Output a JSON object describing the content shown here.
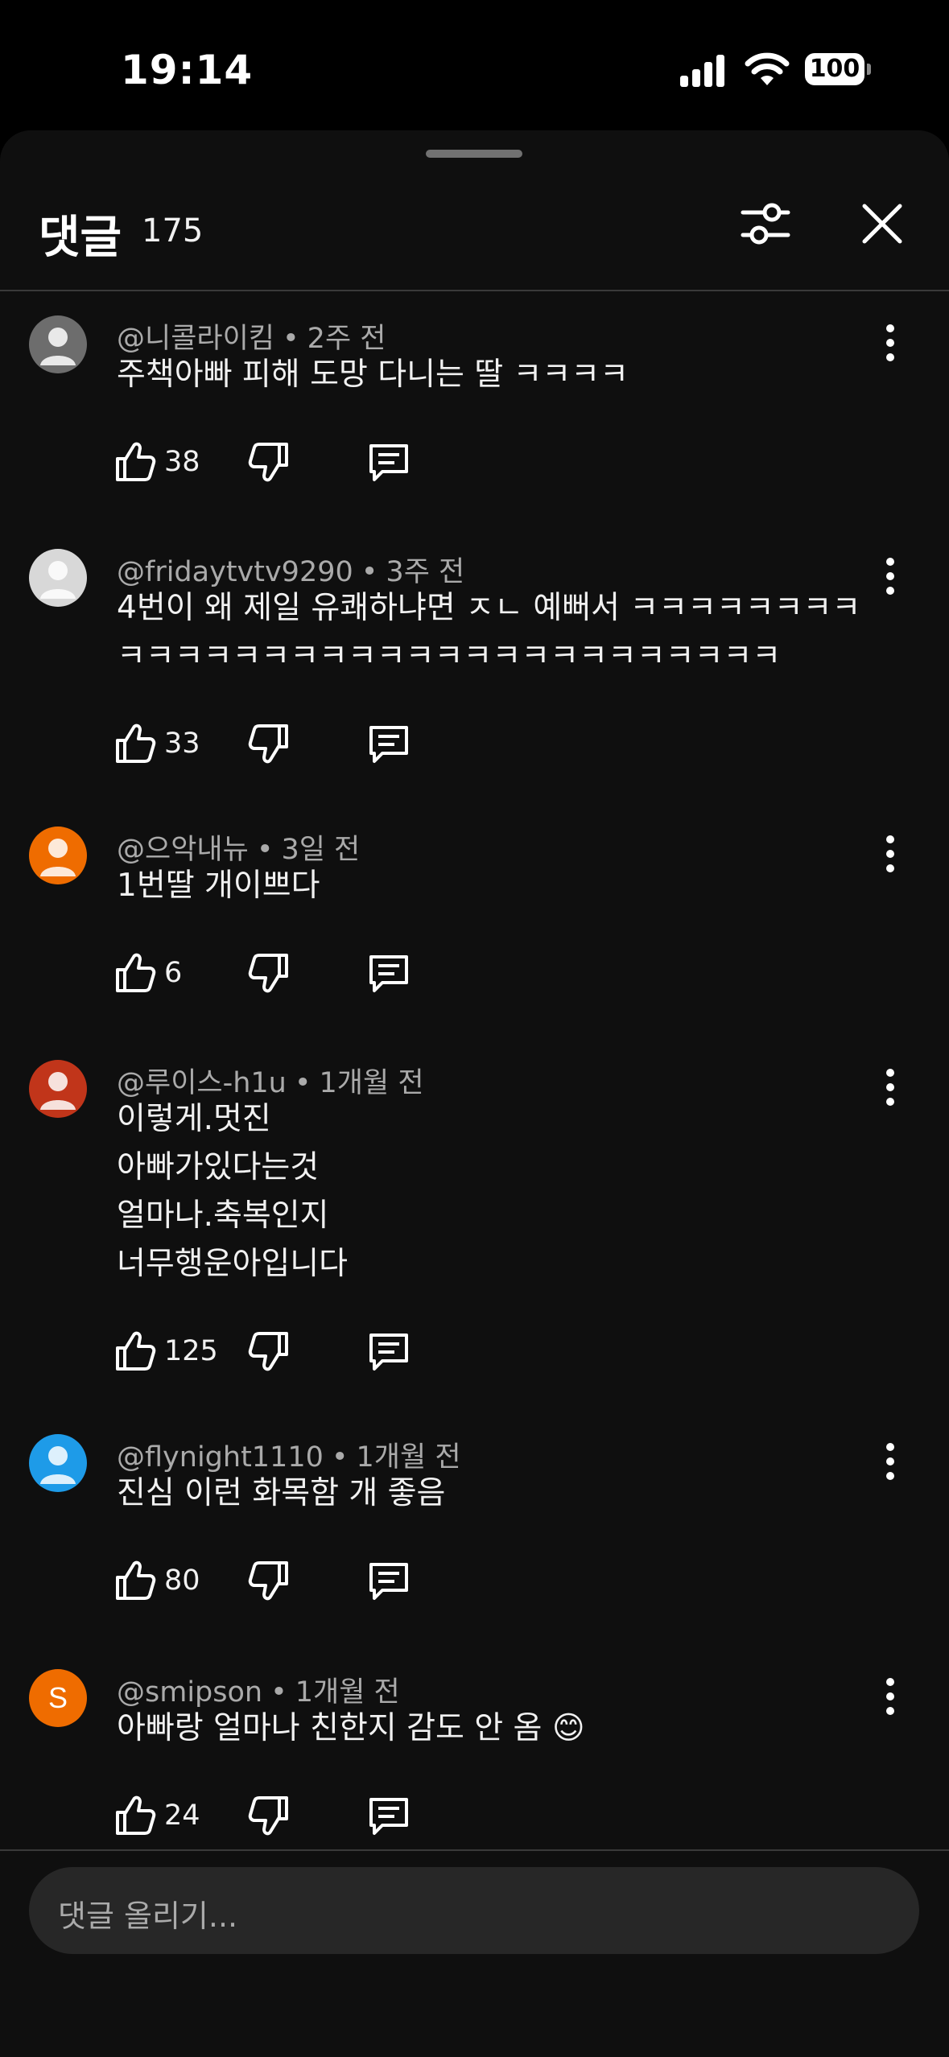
{
  "status": {
    "time": "19:14",
    "battery": "100"
  },
  "header": {
    "title": "댓글",
    "count": "175"
  },
  "comments": [
    {
      "author": "@니콜라이킴",
      "age": "2주 전",
      "text": "주책아빠 피해 도망 다니는 딸 ㅋㅋㅋㅋ",
      "likes": "38",
      "avatar_color": "#6d6d6d"
    },
    {
      "author": "@fridaytvtv9290",
      "age": "3주 전",
      "text": "4번이 왜 제일 유쾌하냐면 ㅈㄴ 예뻐서 ㅋㅋㅋㅋㅋㅋㅋㅋ\nㅋㅋㅋㅋㅋㅋㅋㅋㅋㅋㅋㅋㅋㅋㅋㅋㅋㅋㅋㅋㅋㅋㅋ",
      "likes": "33",
      "avatar_color": "#d8d8d8"
    },
    {
      "author": "@으악내뉴",
      "age": "3일 전",
      "text": "1번딸 개이쁘다",
      "likes": "6",
      "avatar_color": "#ef6c00"
    },
    {
      "author": "@루이스-h1u",
      "age": "1개월 전",
      "text": "이렇게.멋진\n아빠가있다는것\n얼마나.축복인지\n너무행운아입니다",
      "likes": "125",
      "avatar_color": "#c1351a"
    },
    {
      "author": "@flynight1110",
      "age": "1개월 전",
      "text": "진심 이런 화목함 개 좋음",
      "likes": "80",
      "avatar_color": "#1e9be8"
    },
    {
      "author": "@smipson",
      "age": "1개월 전",
      "text": "아빠랑 얼마나 친한지 감도 안 옴 😊",
      "likes": "24",
      "avatar_color": "#ef6c00",
      "initial": "S"
    }
  ],
  "composer": {
    "placeholder": "댓글 올리기..."
  }
}
